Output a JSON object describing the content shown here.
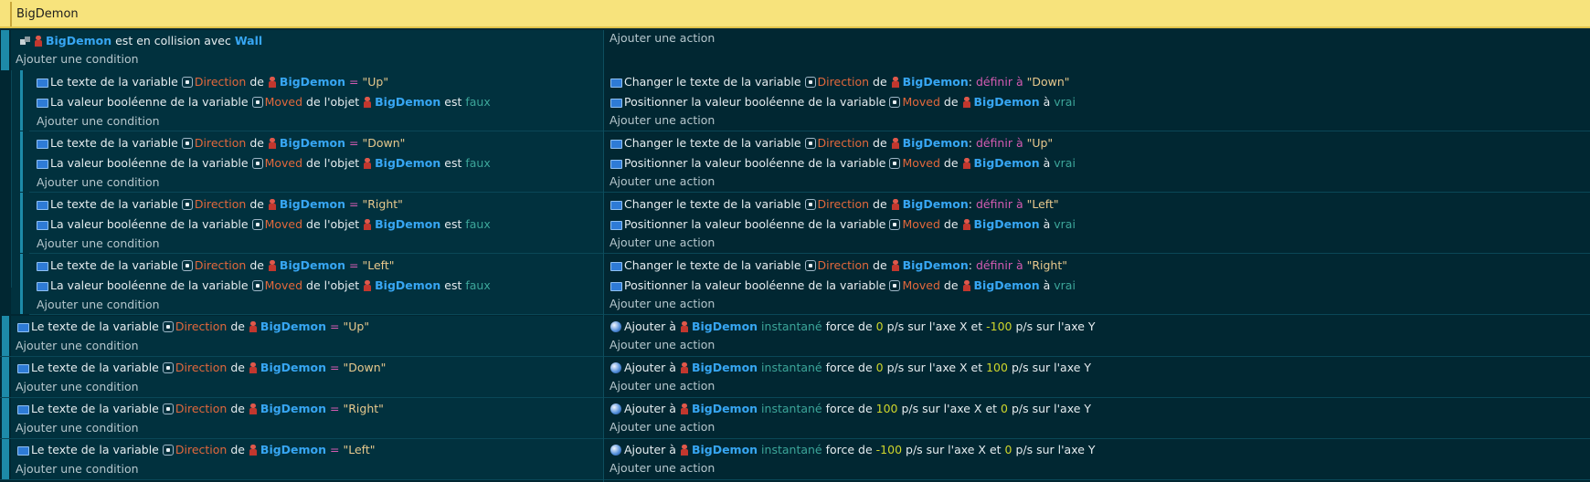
{
  "group": {
    "title": "BigDemon"
  },
  "add_condition": "Ajouter une condition",
  "add_action": "Ajouter une action",
  "collision": {
    "object": "BigDemon",
    "mid": " est en collision avec ",
    "target": "Wall"
  },
  "sub": [
    {
      "val": "\"Up\"",
      "set": "\"Down\""
    },
    {
      "val": "\"Down\"",
      "set": "\"Up\""
    },
    {
      "val": "\"Right\"",
      "set": "\"Left\""
    },
    {
      "val": "\"Left\"",
      "set": "\"Right\""
    }
  ],
  "bottom": [
    {
      "val": "\"Up\"",
      "fx": "0",
      "fy": "-100"
    },
    {
      "val": "\"Down\"",
      "fx": "0",
      "fy": "100"
    },
    {
      "val": "\"Right\"",
      "fx": "100",
      "fy": "0"
    },
    {
      "val": "\"Left\"",
      "fx": "-100",
      "fy": "0"
    }
  ],
  "t": {
    "text_var": "Le texte de la variable ",
    "bool_var": "La valeur booléenne de la variable ",
    "var_dir": "Direction",
    "var_moved": "Moved",
    "de": " de ",
    "de_obj": " de l'objet ",
    "eq": " = ",
    "est": " est ",
    "faux": "faux",
    "vrai": "vrai",
    "change_text": "Changer le texte de la variable ",
    "define": "définir à ",
    "set_bool": "Positionner la valeur booléenne de la variable ",
    "a": " à ",
    "colon": ": ",
    "add_to": "Ajouter à ",
    "inst": " instantané ",
    "force": " force de ",
    "ps_x": " p/s sur l'axe X et ",
    "ps_y": " p/s sur l'axe Y",
    "obj": "BigDemon"
  },
  "colors": {
    "background": "#012732",
    "group_bar": "#f7e37c",
    "object": "#37a6f3",
    "variable": "#e2683c",
    "string": "#e8c98d",
    "keyword": "#3ca69a",
    "number": "#cfd62b",
    "operator": "#d45bb2"
  }
}
